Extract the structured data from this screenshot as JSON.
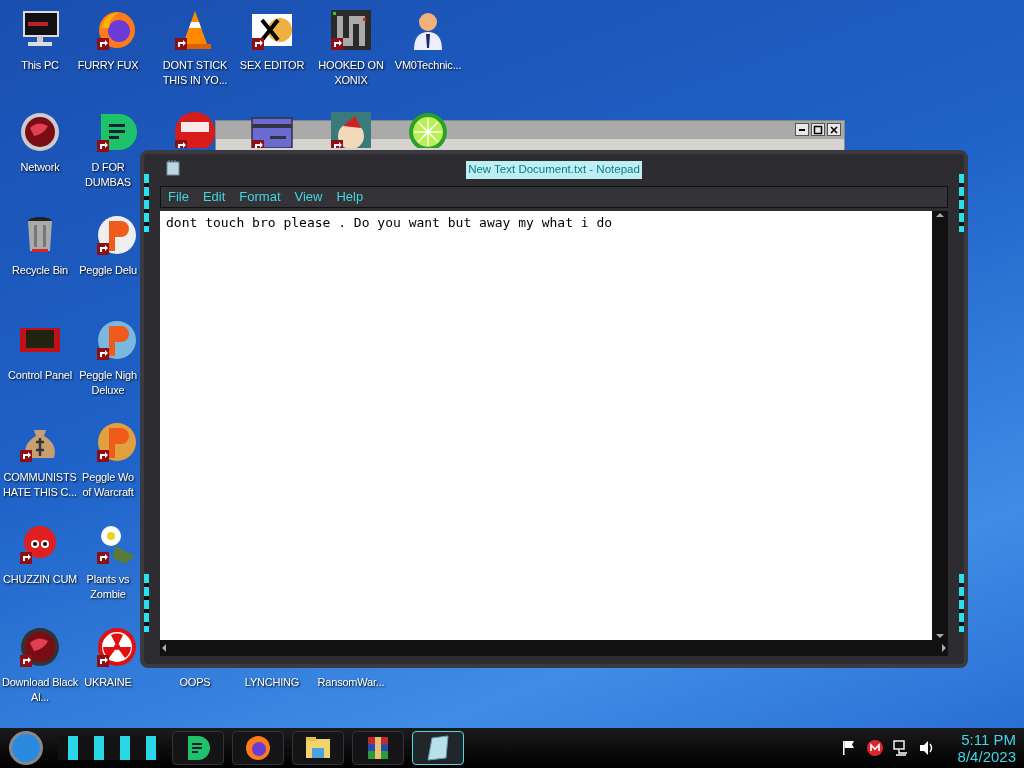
{
  "desktop": {
    "icons": [
      {
        "label": "This PC"
      },
      {
        "label": "FURRY FUX"
      },
      {
        "label": "DONT STICK THIS IN YO..."
      },
      {
        "label": "SEX EDITOR"
      },
      {
        "label": "HOOKED ON XONIX"
      },
      {
        "label": "VM0Technic..."
      },
      {
        "label": "Network"
      },
      {
        "label": "D FOR DUMBAS"
      },
      {
        "label": "Recycle Bin"
      },
      {
        "label": "Peggle Delu"
      },
      {
        "label": "Control Panel"
      },
      {
        "label": "Peggle Nigh Deluxe"
      },
      {
        "label": "COMMUNISTS HATE THIS C..."
      },
      {
        "label": "Peggle Wo of Warcraft"
      },
      {
        "label": "CHUZZIN CUM"
      },
      {
        "label": "Plants vs Zombie"
      },
      {
        "label": "Download Black Al..."
      },
      {
        "label": "UKRAINE"
      },
      {
        "label": "OOPS"
      },
      {
        "label": "LYNCHING"
      },
      {
        "label": "RansomWar..."
      }
    ]
  },
  "notepad": {
    "title": "New Text Document.txt - Notepad",
    "menu": [
      "File",
      "Edit",
      "Format",
      "View",
      "Help"
    ],
    "text": "dont touch bro please . Do you want but away my what i do"
  },
  "taskbar": {
    "apps": [
      {
        "selected": false
      },
      {
        "selected": false
      },
      {
        "selected": false
      },
      {
        "selected": false
      },
      {
        "selected": true
      }
    ],
    "clock": {
      "time": "5:11 PM",
      "date": "8/4/2023"
    }
  }
}
